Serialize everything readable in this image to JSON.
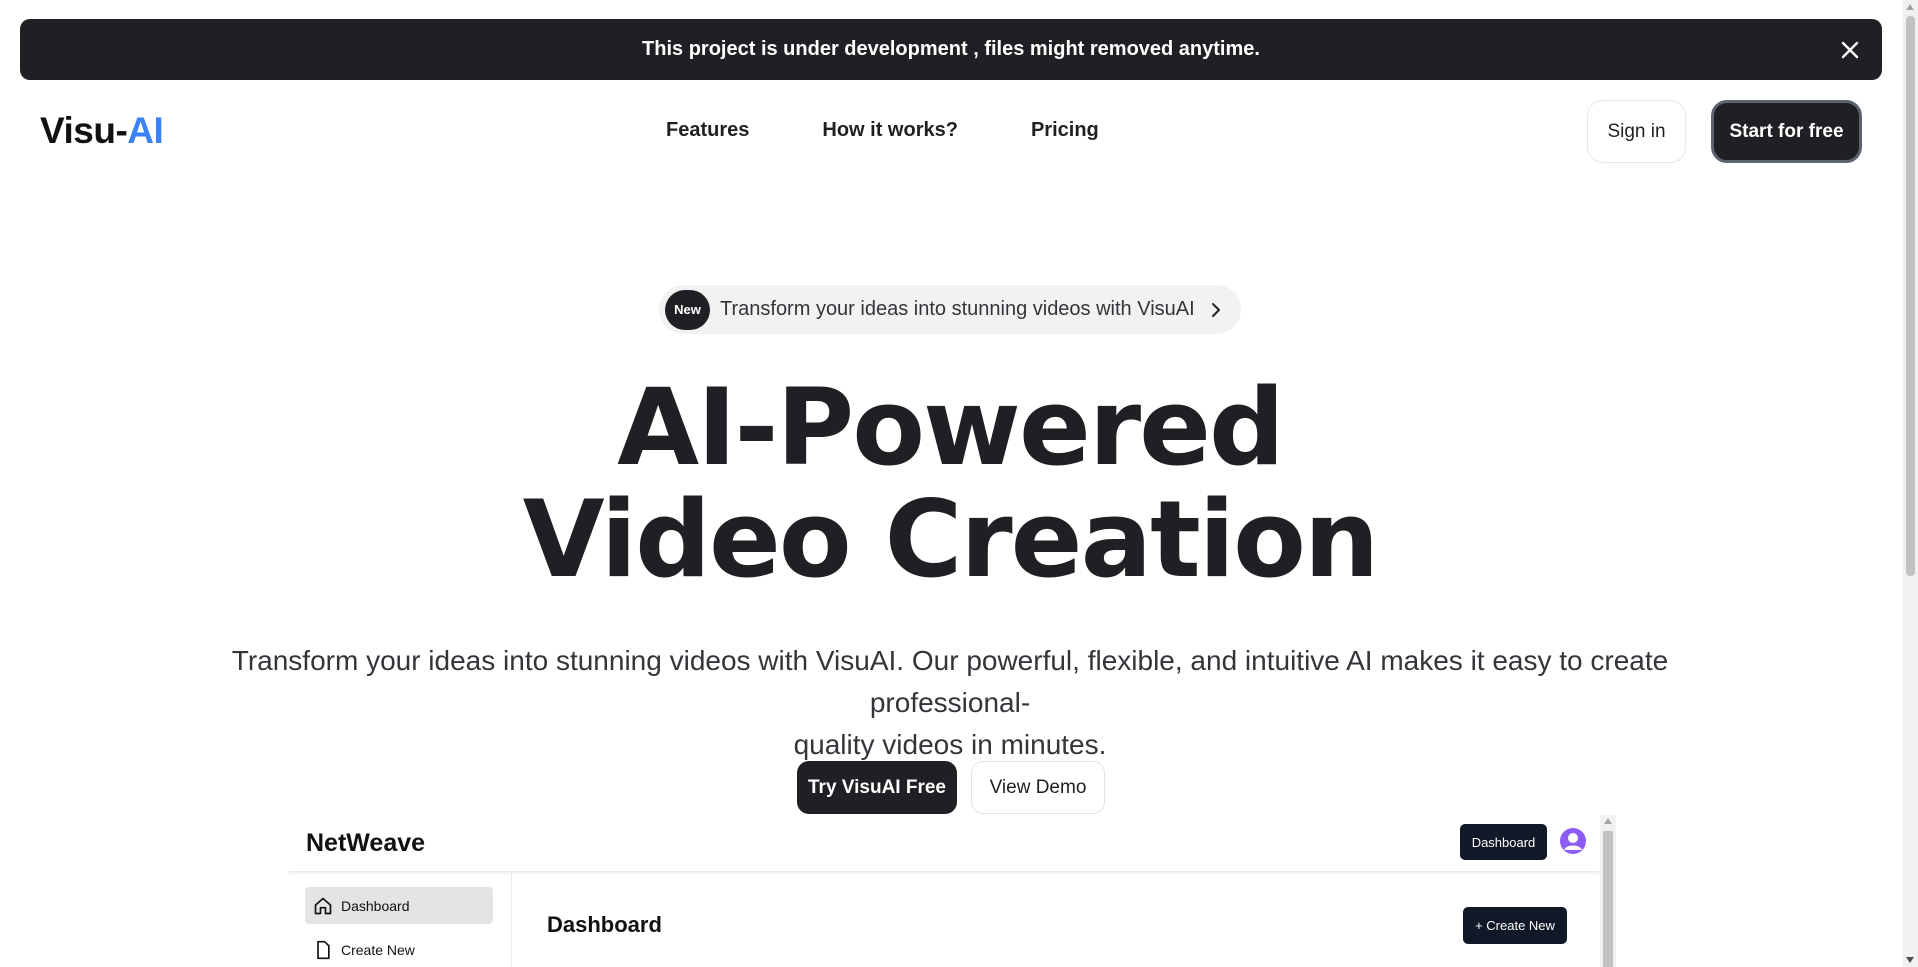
{
  "banner": {
    "message": "This project is under development , files might removed anytime.",
    "close_icon": "close-icon"
  },
  "header": {
    "logo_main": "Visu-",
    "logo_accent": "AI",
    "nav": [
      "Features",
      "How it works?",
      "Pricing"
    ],
    "sign_in": "Sign in",
    "start_free": "Start for free"
  },
  "hero": {
    "pill_badge": "New",
    "pill_text": "Transform your ideas into stunning videos with VisuAI",
    "title_line1": "AI-Powered",
    "title_line2": "Video Creation",
    "subtitle_line1": "Transform your ideas into stunning videos with VisuAI. Our powerful, flexible, and intuitive AI makes it easy to create professional-",
    "subtitle_line2": "quality videos in minutes.",
    "cta_primary": "Try VisuAI Free",
    "cta_secondary": "View Demo"
  },
  "preview": {
    "brand": "NetWeave",
    "header_button": "Dashboard",
    "sidebar": [
      "Dashboard",
      "Create New"
    ],
    "main_title": "Dashboard",
    "create_button": "+ Create New"
  },
  "colors": {
    "dark": "#1f2023",
    "accent": "#3b82f6",
    "avatar": "#8b5cf6",
    "preview_button": "#111827"
  }
}
